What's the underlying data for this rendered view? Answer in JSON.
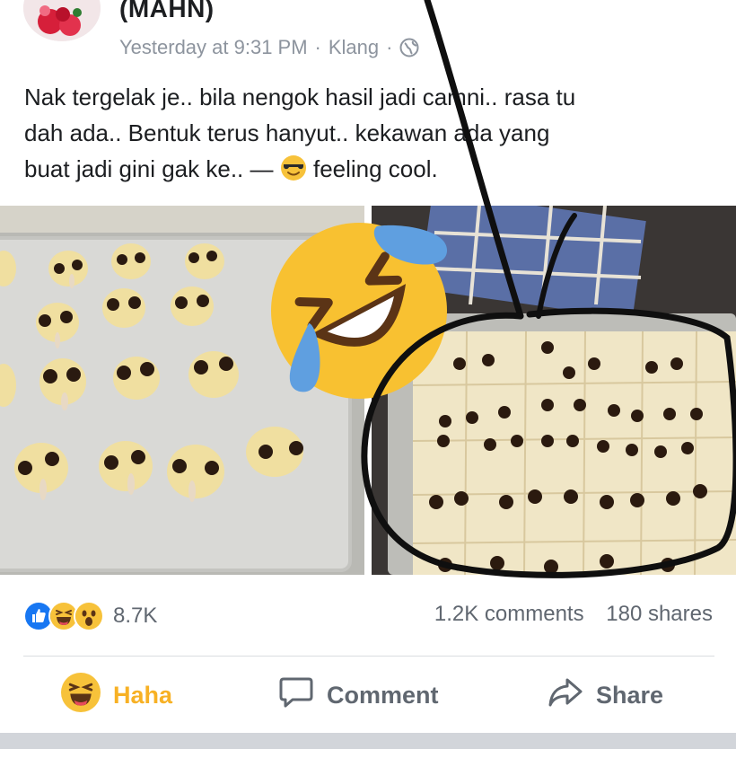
{
  "post": {
    "author": "(MAHN)",
    "time": "Yesterday at 9:31 PM",
    "separator": "·",
    "location": "Klang",
    "privacy_icon": "globe-icon",
    "text_lines": [
      "Nak tergelak je.. bila nengok hasil jadi camni.. rasa tu",
      "dah ada.. Bentuk terus hanyut.. kekawan ada yang",
      "buat jadi gini gak ke.. —"
    ],
    "feeling_icon": "sunglasses-emoji-icon",
    "feeling_text": "feeling cool."
  },
  "overlay": {
    "emoji_icon": "rolling-on-floor-laughing-icon",
    "scribble": "hand-drawn-circle-and-arrow"
  },
  "stats": {
    "reaction_icons": [
      "like-icon",
      "haha-icon",
      "wow-icon"
    ],
    "reaction_count": "8.7K",
    "comments": "1.2K comments",
    "shares": "180 shares"
  },
  "actions": {
    "haha_label": "Haha",
    "comment_label": "Comment",
    "share_label": "Share"
  },
  "colors": {
    "haha_active": "#f7b125",
    "like_blue": "#1877f2",
    "text": "#1c1e21",
    "muted": "#606770",
    "meta": "#8d949e"
  }
}
